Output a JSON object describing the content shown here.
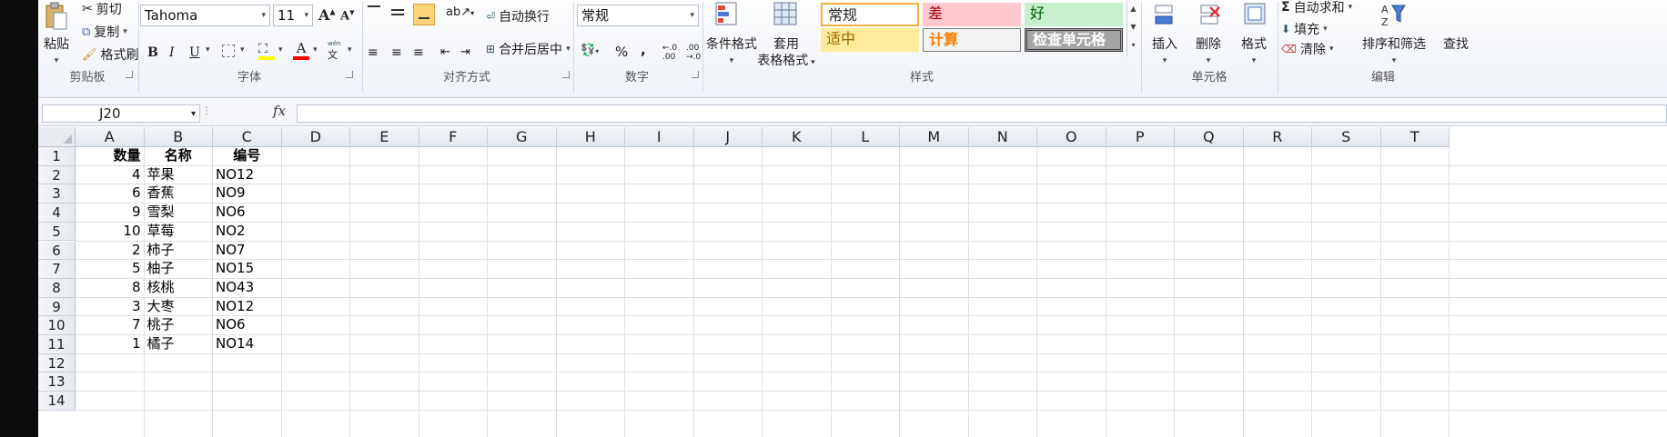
{
  "ribbon": {
    "clipboard": {
      "paste": "粘贴",
      "cut": "剪切",
      "copy": "复制",
      "format_painter": "格式刷",
      "group": "剪贴板"
    },
    "font": {
      "name": "Tahoma",
      "size": "11",
      "bold": "B",
      "italic": "I",
      "underline": "U",
      "grow": "A",
      "shrink": "A",
      "font_color_letter": "A",
      "phonetic": "wén",
      "group": "字体"
    },
    "alignment": {
      "wrap": "自动换行",
      "merge": "合并后居中",
      "group": "对齐方式"
    },
    "number": {
      "format": "常规",
      "percent": "%",
      "comma": ",",
      "inc_dec": "←.0\n.00",
      "dec_dec": ".00\n→.0",
      "group": "数字"
    },
    "styles": {
      "cond_format": "条件格式",
      "table_format_1": "套用",
      "table_format_2": "表格格式",
      "cells": [
        "常规",
        "差",
        "好",
        "适中",
        "计算",
        "检查单元格"
      ],
      "group": "样式"
    },
    "cells": {
      "insert": "插入",
      "delete": "删除",
      "format": "格式",
      "group": "单元格"
    },
    "editing": {
      "autosum": "自动求和",
      "fill": "填充",
      "clear": "清除",
      "sort": "排序和筛选",
      "find": "查找",
      "group": "编辑"
    }
  },
  "formula_bar": {
    "name_box": "J20",
    "fx": "fx",
    "value": ""
  },
  "columns": [
    "A",
    "B",
    "C",
    "D",
    "E",
    "F",
    "G",
    "H",
    "I",
    "J",
    "K",
    "L",
    "M",
    "N",
    "O",
    "P",
    "Q",
    "R",
    "S",
    "T"
  ],
  "rows": [
    "1",
    "2",
    "3",
    "4",
    "5",
    "6",
    "7",
    "8",
    "9",
    "10",
    "11",
    "12",
    "13",
    "14"
  ],
  "table": {
    "headers": [
      "数量",
      "名称",
      "编号"
    ],
    "data": [
      [
        "4",
        "苹果",
        "NO12"
      ],
      [
        "6",
        "香蕉",
        "NO9"
      ],
      [
        "9",
        "雪梨",
        "NO6"
      ],
      [
        "10",
        "草莓",
        "NO2"
      ],
      [
        "2",
        "柿子",
        "NO7"
      ],
      [
        "5",
        "柚子",
        "NO15"
      ],
      [
        "8",
        "核桃",
        "NO43"
      ],
      [
        "3",
        "大枣",
        "NO12"
      ],
      [
        "7",
        "桃子",
        "NO6"
      ],
      [
        "1",
        "橘子",
        "NO14"
      ]
    ]
  },
  "colors": {
    "neutral_bg": "#ffeb9c",
    "neutral_fg": "#9c6500",
    "bad_bg": "#ffc7ce",
    "bad_fg": "#9c0006",
    "good_bg": "#c6efce",
    "good_fg": "#006100",
    "calc_fg": "#fa7d00",
    "check_bg": "#a5a5a5"
  }
}
